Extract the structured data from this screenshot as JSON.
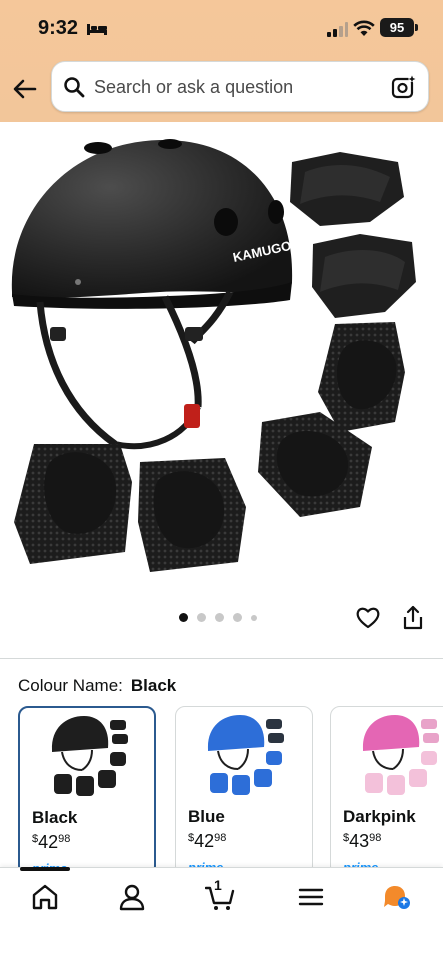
{
  "status_bar": {
    "time": "9:32",
    "battery": "95"
  },
  "search": {
    "placeholder": "Search or ask a question"
  },
  "product_image": {
    "brand": "KAMUGO"
  },
  "carousel": {
    "total_dots": 5,
    "active_index": 0
  },
  "variation": {
    "label": "Colour Name:",
    "selected": "Black",
    "options": [
      {
        "name": "Black",
        "currency": "$",
        "dollars": "42",
        "cents": "98",
        "prime": "prime",
        "color": "#1e1e1e"
      },
      {
        "name": "Blue",
        "currency": "$",
        "dollars": "42",
        "cents": "98",
        "prime": "prime",
        "color": "#2d6ed8"
      },
      {
        "name": "Darkpink",
        "currency": "$",
        "dollars": "43",
        "cents": "98",
        "prime": "prime",
        "color": "#e466b4"
      }
    ]
  },
  "tabbar": {
    "cart_count": "1"
  },
  "colors": {
    "header_bg": "#f2c69a",
    "selected_border": "#2b5a8f",
    "prime_blue": "#1a98ff"
  }
}
